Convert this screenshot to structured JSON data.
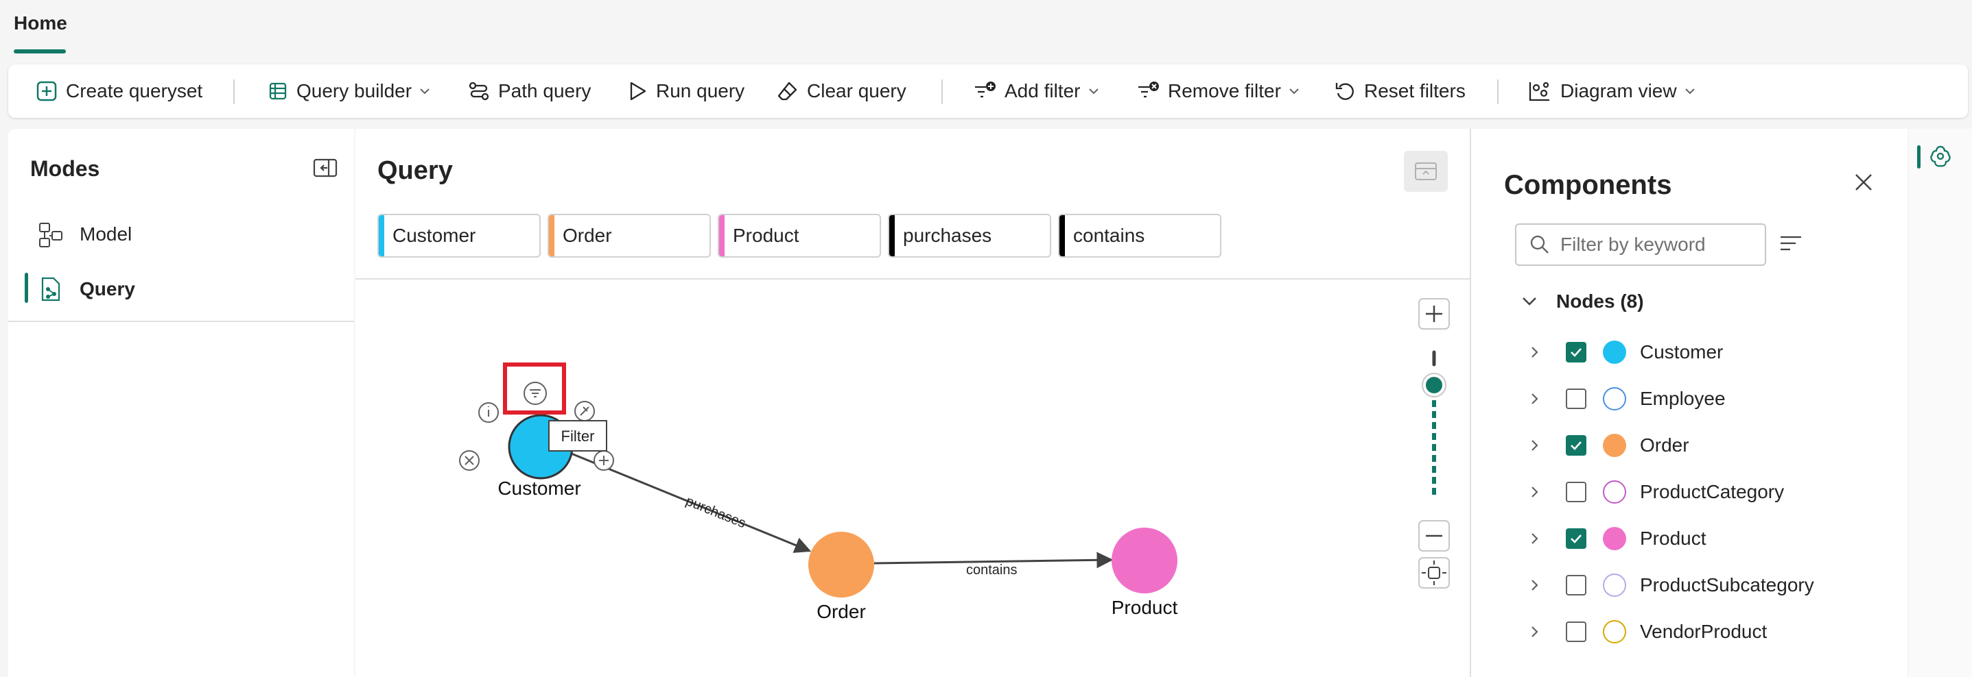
{
  "header": {
    "tab": "Home"
  },
  "toolbar": {
    "create_queryset": "Create queryset",
    "query_builder": "Query builder",
    "path_query": "Path query",
    "run_query": "Run query",
    "clear_query": "Clear query",
    "add_filter": "Add filter",
    "remove_filter": "Remove filter",
    "reset_filters": "Reset filters",
    "diagram_view": "Diagram view"
  },
  "modes": {
    "title": "Modes",
    "items": [
      {
        "label": "Model",
        "selected": false
      },
      {
        "label": "Query",
        "selected": true
      }
    ]
  },
  "query": {
    "title": "Query",
    "chips": [
      {
        "label": "Customer",
        "color": "#1ec0f0"
      },
      {
        "label": "Order",
        "color": "#f8a058"
      },
      {
        "label": "Product",
        "color": "#f070c8"
      },
      {
        "label": "purchases",
        "color": "#000000"
      },
      {
        "label": "contains",
        "color": "#000000"
      }
    ]
  },
  "graph": {
    "nodes": [
      {
        "label": "Customer",
        "color": "#1ec0f0"
      },
      {
        "label": "Order",
        "color": "#f8a058"
      },
      {
        "label": "Product",
        "color": "#f070c8"
      }
    ],
    "edges": [
      {
        "label": "purchases"
      },
      {
        "label": "contains"
      }
    ],
    "tooltip": "Filter"
  },
  "components": {
    "title": "Components",
    "search_placeholder": "Filter by keyword",
    "nodes_header": "Nodes (8)",
    "items": [
      {
        "label": "Customer",
        "checked": true,
        "color": "#1ec0f0",
        "filled": true
      },
      {
        "label": "Employee",
        "checked": false,
        "color": "#4a90e2",
        "filled": false
      },
      {
        "label": "Order",
        "checked": true,
        "color": "#f8a058",
        "filled": true
      },
      {
        "label": "ProductCategory",
        "checked": false,
        "color": "#c05cc8",
        "filled": false
      },
      {
        "label": "Product",
        "checked": true,
        "color": "#f070c8",
        "filled": true
      },
      {
        "label": "ProductSubcategory",
        "checked": false,
        "color": "#b8a8e8",
        "filled": false
      },
      {
        "label": "VendorProduct",
        "checked": false,
        "color": "#d8a800",
        "filled": false
      }
    ]
  }
}
